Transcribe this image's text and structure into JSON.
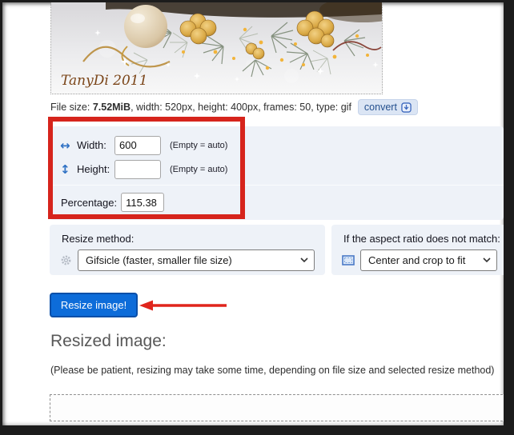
{
  "photo": {
    "signature": "TanyDi 2011"
  },
  "file_info": {
    "label": "File size:",
    "size": "7.52MiB",
    "details": ", width: 520px, height: 400px, frames: 50, type: gif",
    "convert_label": "convert"
  },
  "resize_form": {
    "width_label": "Width:",
    "width_value": "600",
    "width_hint": "(Empty = auto)",
    "height_label": "Height:",
    "height_value": "",
    "height_hint": "(Empty = auto)",
    "percentage_label": "Percentage:",
    "percentage_value": "115.38"
  },
  "method_panel": {
    "label": "Resize method:",
    "selected": "Gifsicle (faster, smaller file size)"
  },
  "aspect_panel": {
    "label": "If the aspect ratio does not match:",
    "selected": "Center and crop to fit"
  },
  "actions": {
    "resize_button": "Resize image!"
  },
  "result_section": {
    "heading": "Resized image:",
    "note": "(Please be patient, resizing may take some time, depending on file size and selected resize method)"
  },
  "colors": {
    "annotation_red": "#d6241c",
    "button_blue": "#0d6cd9",
    "panel_background": "#eef2f8",
    "convert_badge_blue": "#24508e"
  }
}
